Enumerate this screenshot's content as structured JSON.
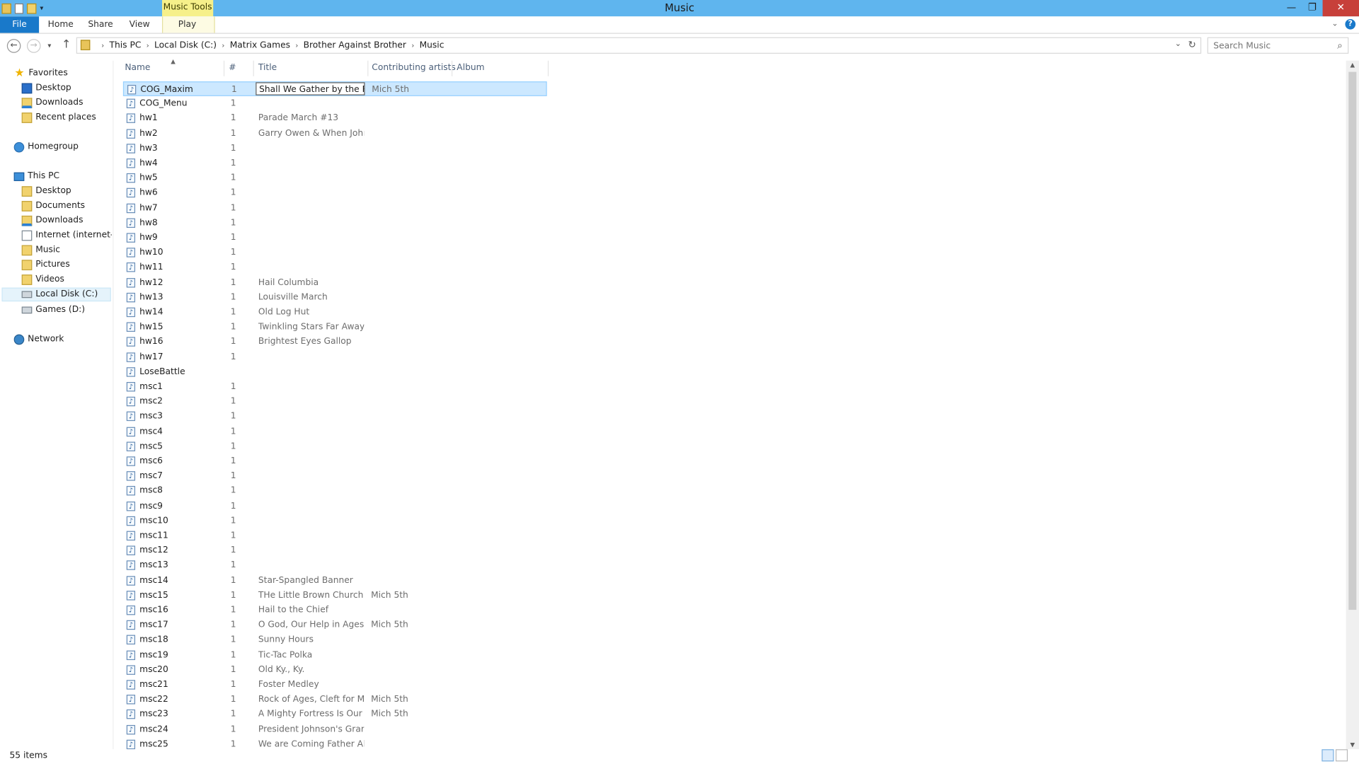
{
  "window": {
    "title": "Music",
    "context_tab": "Music Tools",
    "close_label": "✕",
    "minimize_label": "—",
    "restore_label": "❐"
  },
  "ribbon": {
    "tabs": [
      "File",
      "Home",
      "Share",
      "View",
      "Play"
    ]
  },
  "address": {
    "crumbs": [
      "This PC",
      "Local Disk (C:)",
      "Matrix Games",
      "Brother Against Brother",
      "Music"
    ],
    "search_placeholder": "Search Music"
  },
  "sidebar": {
    "favorites": {
      "label": "Favorites",
      "items": [
        "Desktop",
        "Downloads",
        "Recent places"
      ]
    },
    "homegroup": "Homegroup",
    "this_pc": {
      "label": "This PC",
      "items": [
        "Desktop",
        "Documents",
        "Downloads",
        "Internet (internet-pc",
        "Music",
        "Pictures",
        "Videos",
        "Local Disk (C:)",
        "Games (D:)"
      ]
    },
    "network": "Network"
  },
  "columns": {
    "name": "Name",
    "num": "#",
    "title": "Title",
    "artists": "Contributing artists",
    "album": "Album"
  },
  "files": [
    {
      "name": "COG_Maxim",
      "num": "1",
      "title": "Shall We Gather by the River",
      "artist": "Mich 5th"
    },
    {
      "name": "COG_Menu",
      "num": "1",
      "title": "",
      "artist": ""
    },
    {
      "name": "hw1",
      "num": "1",
      "title": "Parade March #13",
      "artist": ""
    },
    {
      "name": "hw2",
      "num": "1",
      "title": "Garry Owen & When John...",
      "artist": ""
    },
    {
      "name": "hw3",
      "num": "1",
      "title": "",
      "artist": ""
    },
    {
      "name": "hw4",
      "num": "1",
      "title": "",
      "artist": ""
    },
    {
      "name": "hw5",
      "num": "1",
      "title": "",
      "artist": ""
    },
    {
      "name": "hw6",
      "num": "1",
      "title": "",
      "artist": ""
    },
    {
      "name": "hw7",
      "num": "1",
      "title": "",
      "artist": ""
    },
    {
      "name": "hw8",
      "num": "1",
      "title": "",
      "artist": ""
    },
    {
      "name": "hw9",
      "num": "1",
      "title": "",
      "artist": ""
    },
    {
      "name": "hw10",
      "num": "1",
      "title": "",
      "artist": ""
    },
    {
      "name": "hw11",
      "num": "1",
      "title": "",
      "artist": ""
    },
    {
      "name": "hw12",
      "num": "1",
      "title": "Hail Columbia",
      "artist": ""
    },
    {
      "name": "hw13",
      "num": "1",
      "title": "Louisville March",
      "artist": ""
    },
    {
      "name": "hw14",
      "num": "1",
      "title": "Old Log Hut",
      "artist": ""
    },
    {
      "name": "hw15",
      "num": "1",
      "title": "Twinkling Stars Far Away",
      "artist": ""
    },
    {
      "name": "hw16",
      "num": "1",
      "title": "Brightest Eyes Gallop",
      "artist": ""
    },
    {
      "name": "hw17",
      "num": "1",
      "title": "",
      "artist": ""
    },
    {
      "name": "LoseBattle",
      "num": "",
      "title": "",
      "artist": ""
    },
    {
      "name": "msc1",
      "num": "1",
      "title": "",
      "artist": ""
    },
    {
      "name": "msc2",
      "num": "1",
      "title": "",
      "artist": ""
    },
    {
      "name": "msc3",
      "num": "1",
      "title": "",
      "artist": ""
    },
    {
      "name": "msc4",
      "num": "1",
      "title": "",
      "artist": ""
    },
    {
      "name": "msc5",
      "num": "1",
      "title": "",
      "artist": ""
    },
    {
      "name": "msc6",
      "num": "1",
      "title": "",
      "artist": ""
    },
    {
      "name": "msc7",
      "num": "1",
      "title": "",
      "artist": ""
    },
    {
      "name": "msc8",
      "num": "1",
      "title": "",
      "artist": ""
    },
    {
      "name": "msc9",
      "num": "1",
      "title": "",
      "artist": ""
    },
    {
      "name": "msc10",
      "num": "1",
      "title": "",
      "artist": ""
    },
    {
      "name": "msc11",
      "num": "1",
      "title": "",
      "artist": ""
    },
    {
      "name": "msc12",
      "num": "1",
      "title": "",
      "artist": ""
    },
    {
      "name": "msc13",
      "num": "1",
      "title": "",
      "artist": ""
    },
    {
      "name": "msc14",
      "num": "1",
      "title": "Star-Spangled Banner",
      "artist": ""
    },
    {
      "name": "msc15",
      "num": "1",
      "title": "THe Little Brown Church i...",
      "artist": "Mich 5th"
    },
    {
      "name": "msc16",
      "num": "1",
      "title": "Hail to the Chief",
      "artist": ""
    },
    {
      "name": "msc17",
      "num": "1",
      "title": "O God, Our Help in Ages ...",
      "artist": "Mich 5th"
    },
    {
      "name": "msc18",
      "num": "1",
      "title": "Sunny Hours",
      "artist": ""
    },
    {
      "name": "msc19",
      "num": "1",
      "title": "Tic-Tac Polka",
      "artist": ""
    },
    {
      "name": "msc20",
      "num": "1",
      "title": "Old Ky., Ky.",
      "artist": ""
    },
    {
      "name": "msc21",
      "num": "1",
      "title": "Foster Medley",
      "artist": ""
    },
    {
      "name": "msc22",
      "num": "1",
      "title": "Rock of Ages, Cleft for Me",
      "artist": "Mich 5th"
    },
    {
      "name": "msc23",
      "num": "1",
      "title": "A Mighty Fortress Is Our ...",
      "artist": "Mich 5th"
    },
    {
      "name": "msc24",
      "num": "1",
      "title": "President Johnson's Gran...",
      "artist": ""
    },
    {
      "name": "msc25",
      "num": "1",
      "title": "We are Coming Father Ab...",
      "artist": ""
    }
  ],
  "status": {
    "count": "55 items"
  }
}
